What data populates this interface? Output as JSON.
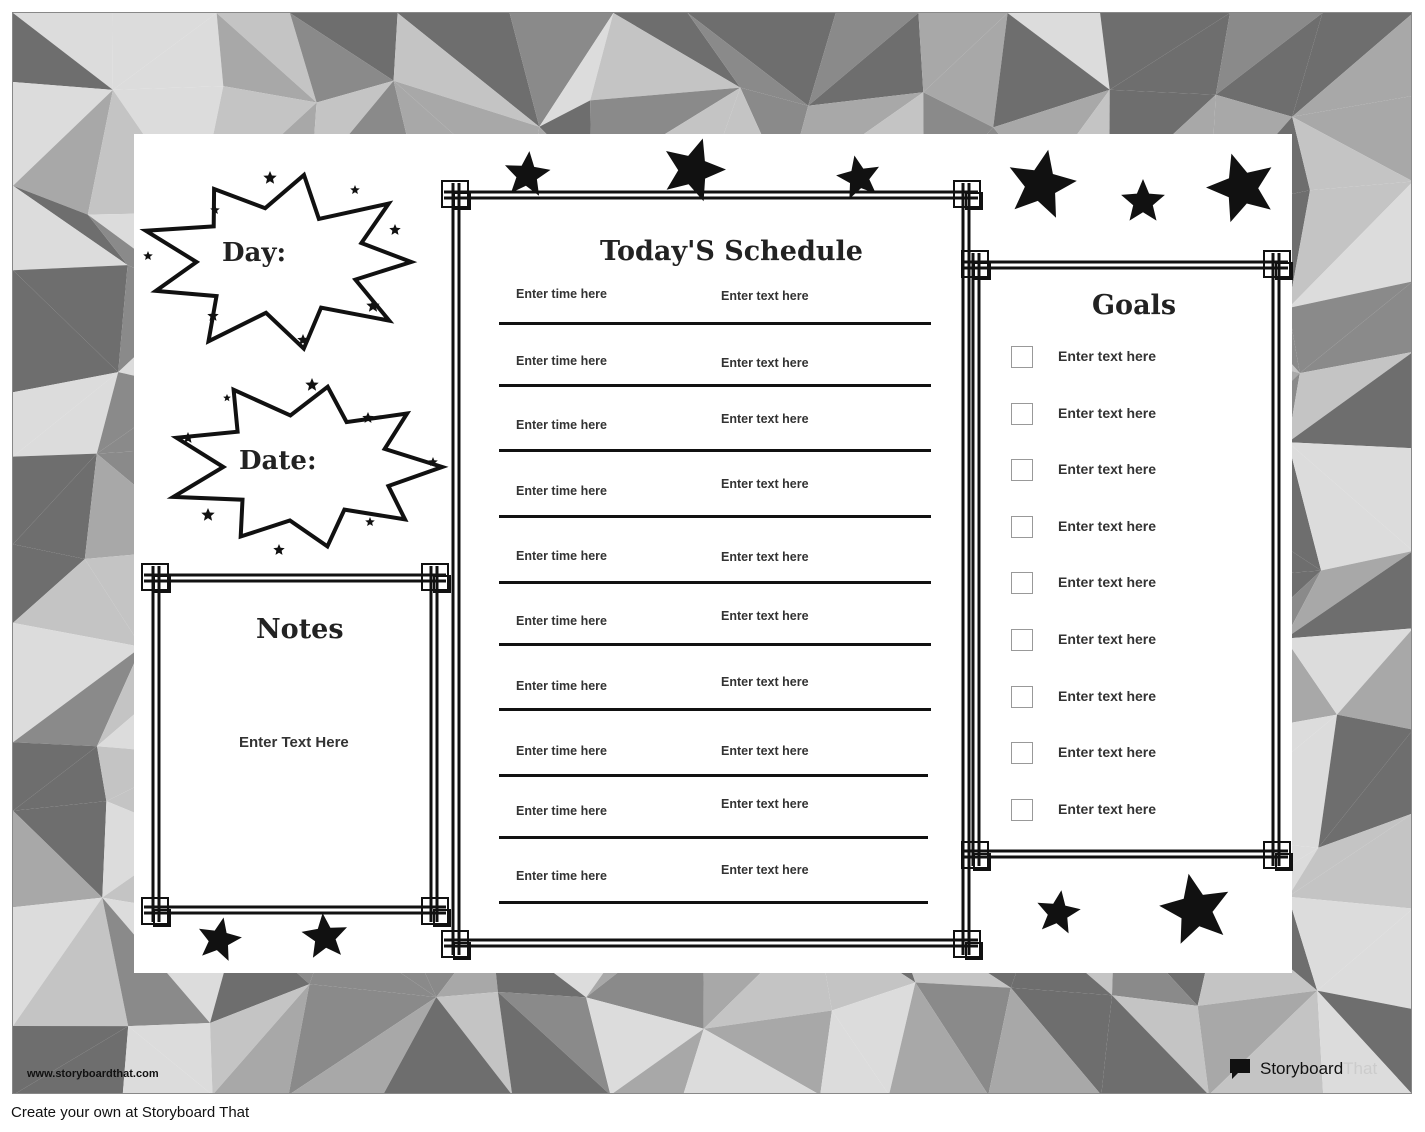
{
  "day_label": "Day:",
  "date_label": "Date:",
  "notes": {
    "title": "Notes",
    "body": "Enter Text Here"
  },
  "schedule": {
    "title": "Today'S Schedule",
    "rows": [
      {
        "time": "Enter time here",
        "text": "Enter text here"
      },
      {
        "time": "Enter time here",
        "text": "Enter text here"
      },
      {
        "time": "Enter time here",
        "text": "Enter text here"
      },
      {
        "time": "Enter time here",
        "text": "Enter text here"
      },
      {
        "time": "Enter time here",
        "text": "Enter text here"
      },
      {
        "time": "Enter time here",
        "text": "Enter text here"
      },
      {
        "time": "Enter time here",
        "text": "Enter text here"
      },
      {
        "time": "Enter time here",
        "text": "Enter text here"
      },
      {
        "time": "Enter time here",
        "text": "Enter text here"
      },
      {
        "time": "Enter time here",
        "text": "Enter text here"
      }
    ]
  },
  "goals": {
    "title": "Goals",
    "items": [
      {
        "text": "Enter text here",
        "checked": false
      },
      {
        "text": "Enter text here",
        "checked": false
      },
      {
        "text": "Enter text here",
        "checked": false
      },
      {
        "text": "Enter text here",
        "checked": false
      },
      {
        "text": "Enter text here",
        "checked": false
      },
      {
        "text": "Enter text here",
        "checked": false
      },
      {
        "text": "Enter text here",
        "checked": false
      },
      {
        "text": "Enter text here",
        "checked": false
      },
      {
        "text": "Enter text here",
        "checked": false
      }
    ]
  },
  "footer": {
    "website": "www.storyboardthat.com",
    "logo_text_dark": "Storyboard",
    "logo_text_light": "That",
    "create_link": "Create your own at Storyboard That"
  },
  "colors": {
    "background_palette": [
      "#6e6e6e",
      "#8a8a8a",
      "#a8a8a8",
      "#c4c4c4",
      "#dcdcdc"
    ],
    "ink": "#111111"
  }
}
